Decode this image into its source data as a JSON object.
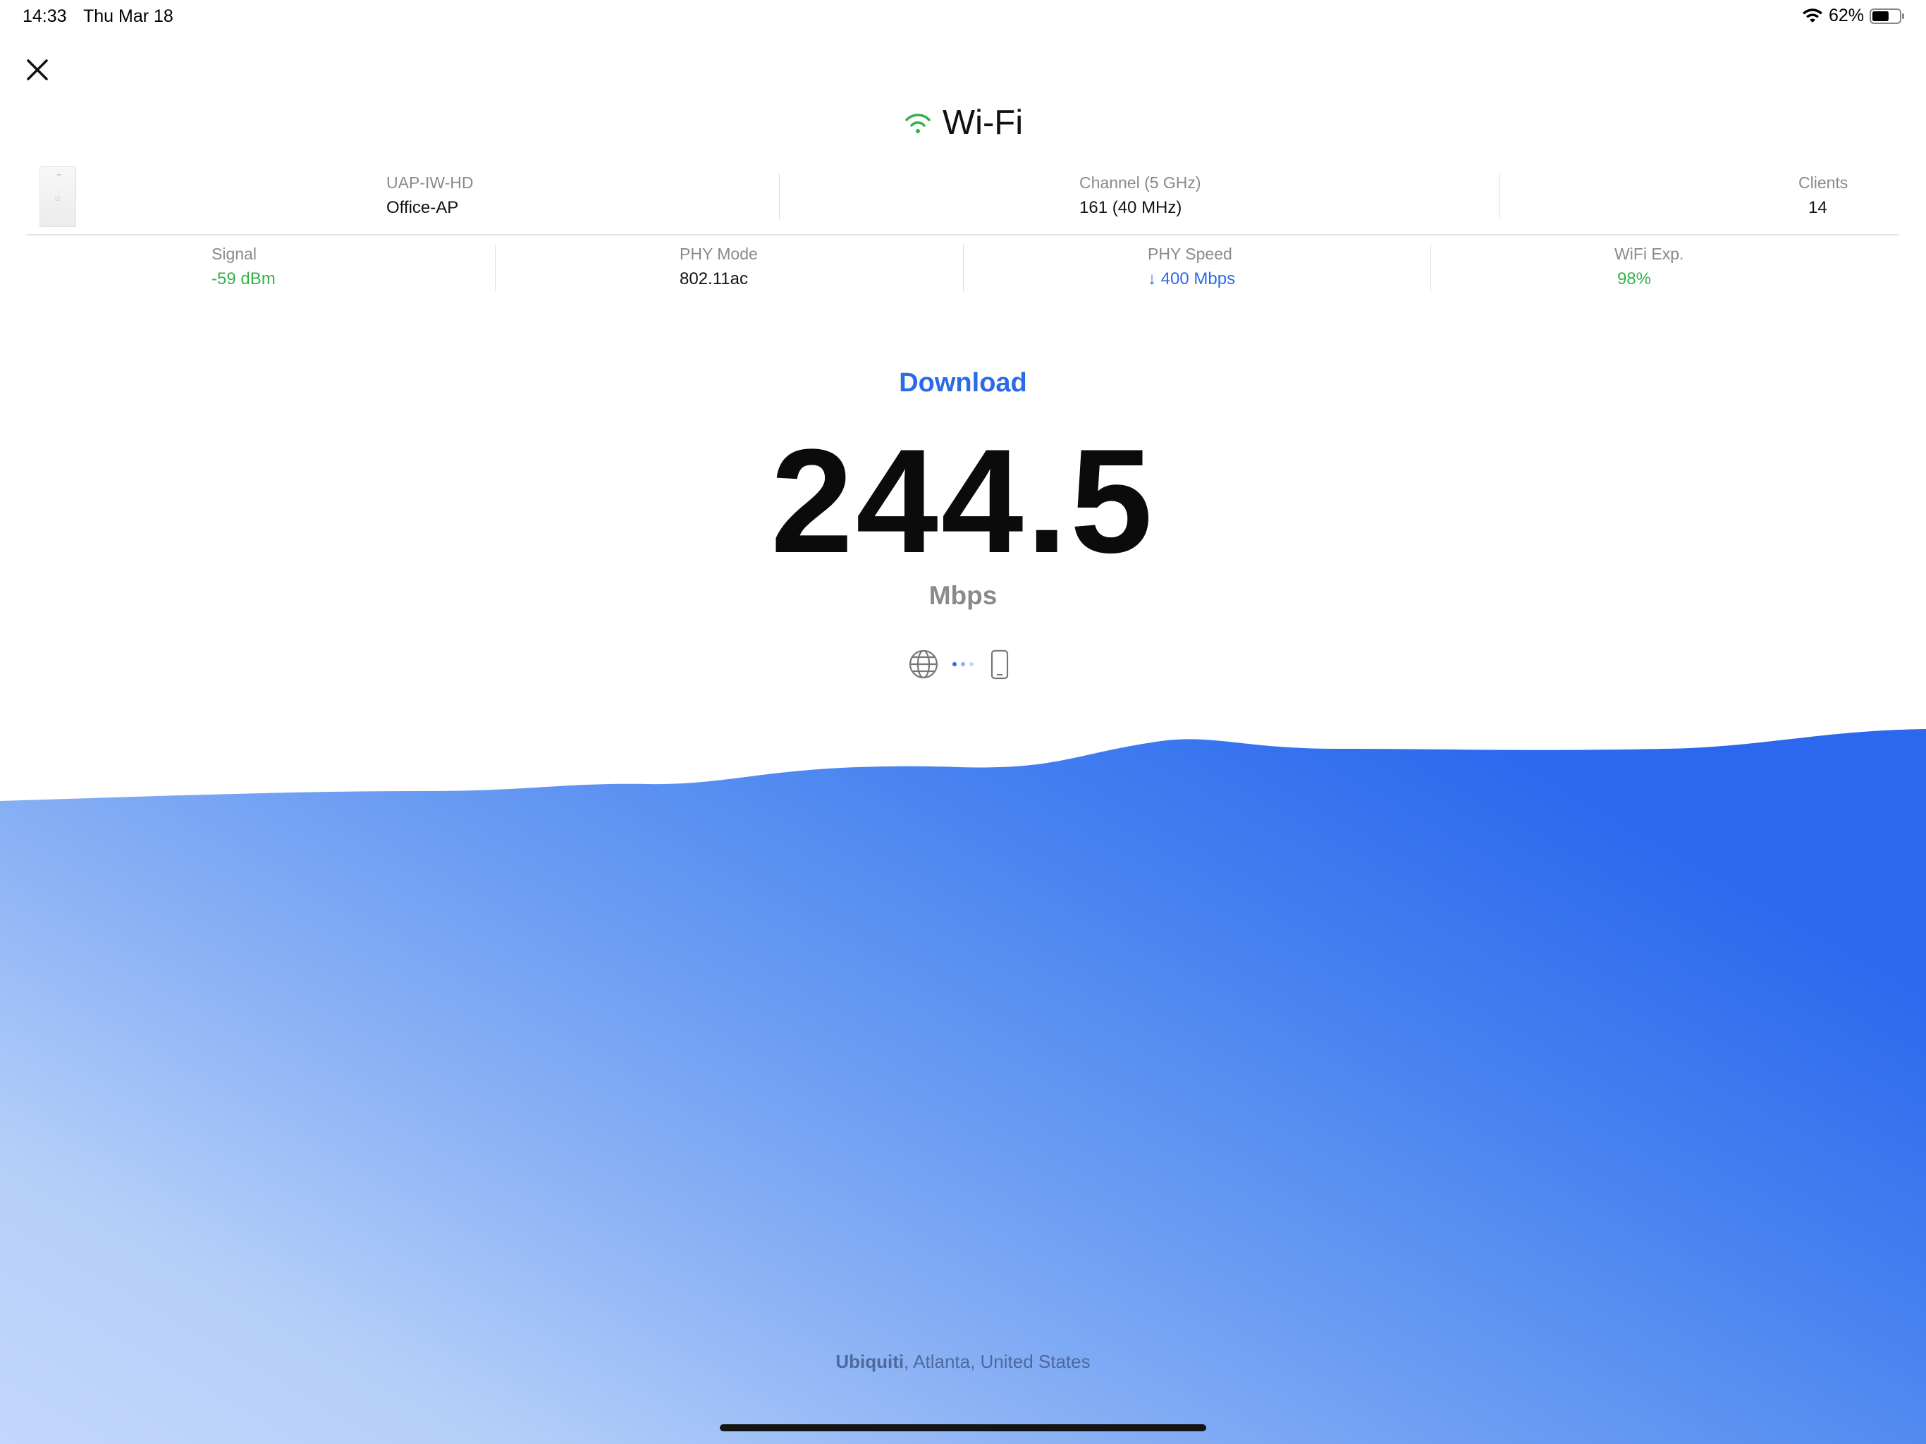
{
  "status_bar": {
    "time": "14:33",
    "date": "Thu Mar 18",
    "battery_percent": "62%",
    "battery_level": 0.62
  },
  "title": "Wi-Fi",
  "device": {
    "model": "UAP-IW-HD",
    "name": "Office-AP",
    "channel_label": "Channel (5 GHz)",
    "channel_value": "161 (40 MHz)",
    "clients_label": "Clients",
    "clients_value": "14"
  },
  "metrics": {
    "signal_label": "Signal",
    "signal_value": "-59 dBm",
    "phy_mode_label": "PHY Mode",
    "phy_mode_value": "802.11ac",
    "phy_speed_label": "PHY Speed",
    "phy_speed_value": "↓ 400 Mbps",
    "wifi_exp_label": "WiFi Exp.",
    "wifi_exp_value": "98%"
  },
  "test": {
    "label": "Download",
    "value": "244.5",
    "unit": "Mbps"
  },
  "server": {
    "provider": "Ubiquiti",
    "location": ", Atlanta, United States"
  },
  "colors": {
    "accent_blue": "#2b6be8",
    "good_green": "#34b24a"
  },
  "icons": {
    "close": "close-icon",
    "wifi": "wifi-icon",
    "globe": "globe-icon",
    "phone": "phone-icon"
  }
}
